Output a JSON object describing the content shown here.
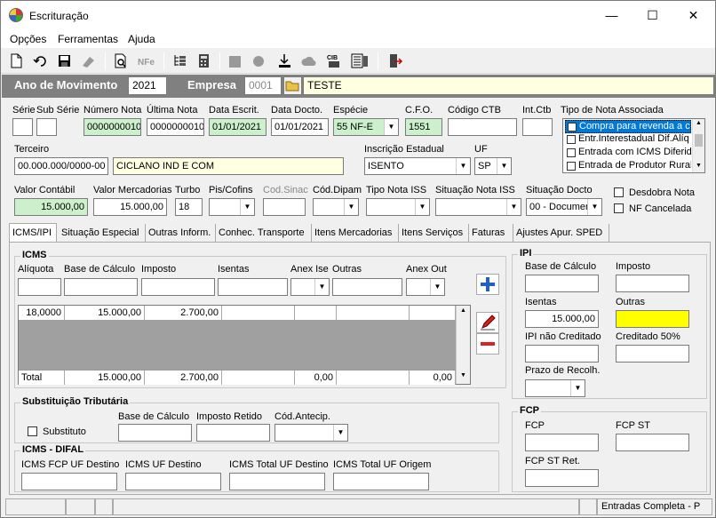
{
  "window": {
    "title": "Escrituração",
    "minimize": "—",
    "maximize": "☐",
    "close": "✕"
  },
  "menu": [
    "Opções",
    "Ferramentas",
    "Ajuda"
  ],
  "header": {
    "ano_label": "Ano de Movimento",
    "ano_value": "2021",
    "empresa_label": "Empresa",
    "empresa_code": "0001",
    "empresa_name": "TESTE"
  },
  "row1": {
    "serie_label": "Série",
    "subserie_label": "Sub Série",
    "numero_label": "Número Nota",
    "numero_value": "0000000010",
    "ultima_label": "Última Nota",
    "ultima_value": "0000000010",
    "data_escrit_label": "Data Escrit.",
    "data_escrit_value": "01/01/2021",
    "data_docto_label": "Data Docto.",
    "data_docto_value": "01/01/2021",
    "especie_label": "Espécie",
    "especie_value": "55  NF-E",
    "cfo_label": "C.F.O.",
    "cfo_value": "1551",
    "ctb_label": "Código CTB",
    "intctb_label": "Int.Ctb",
    "tipo_nota_label": "Tipo de Nota Associada",
    "tipo_nota_items": [
      "Compra para revenda a co",
      "Entr.Interestadual Dif.Alíq",
      "Entrada com ICMS Diferido",
      "Entrada de Produtor Rural"
    ]
  },
  "row2": {
    "terceiro_label": "Terceiro",
    "terceiro_doc": "00.000.000/0000-00",
    "terceiro_name": "CICLANO IND E COM",
    "ie_label": "Inscrição Estadual",
    "ie_value": "ISENTO",
    "uf_label": "UF",
    "uf_value": "SP"
  },
  "row3": {
    "valor_contabil_label": "Valor Contábil",
    "valor_contabil_value": "15.000,00",
    "valor_merc_label": "Valor Mercadorias",
    "valor_merc_value": "15.000,00",
    "turbo_label": "Turbo",
    "turbo_value": "18",
    "piscofins_label": "Pis/Cofins",
    "codsinac_label": "Cod.Sinac",
    "coddipam_label": "Cód.Dipam",
    "tipo_iss_label": "Tipo Nota ISS",
    "sit_iss_label": "Situação Nota ISS",
    "sit_docto_label": "Situação Docto",
    "sit_docto_value": "00 - Documer",
    "desdobra_label": "Desdobra Nota",
    "cancelada_label": "NF Cancelada"
  },
  "tabs": [
    "ICMS/IPI",
    "Situação Especial",
    "Outras Inform.",
    "Conhec. Transporte",
    "Itens Mercadorias",
    "Itens Serviços",
    "Faturas",
    "Ajustes Apur. SPED"
  ],
  "icms": {
    "title": "ICMS",
    "aliquota_label": "Alíquota",
    "base_label": "Base de Cálculo",
    "imposto_label": "Imposto",
    "isentas_label": "Isentas",
    "anexise_label": "Anex Ise",
    "outras_label": "Outras",
    "anexout_label": "Anex Out",
    "row": [
      "18,0000",
      "15.000,00",
      "2.700,00",
      "",
      "",
      "",
      ""
    ],
    "total": [
      "Total",
      "15.000,00",
      "2.700,00",
      "",
      "0,00",
      "",
      "0,00"
    ]
  },
  "st": {
    "title": "Substituição Tributária",
    "substituto_label": "Substituto",
    "base_label": "Base de Cálculo",
    "imposto_label": "Imposto Retido",
    "codantecip_label": "Cód.Antecip."
  },
  "difal": {
    "title": "ICMS - DIFAL",
    "fcp_label": "ICMS FCP UF Destino",
    "uf_dest_label": "ICMS UF Destino",
    "total_dest_label": "ICMS Total UF Destino",
    "total_orig_label": "ICMS Total UF Origem"
  },
  "ipi": {
    "title": "IPI",
    "base_label": "Base de Cálculo",
    "imposto_label": "Imposto",
    "isentas_label": "Isentas",
    "isentas_value": "15.000,00",
    "outras_label": "Outras",
    "naocred_label": "IPI não Creditado",
    "cred50_label": "Creditado 50%",
    "prazo_label": "Prazo de Recolh."
  },
  "fcp": {
    "title": "FCP",
    "fcp_label": "FCP",
    "fcpst_label": "FCP ST",
    "fcpstret_label": "FCP ST Ret."
  },
  "status": {
    "text": "Entradas Completa - P"
  },
  "colors": {
    "band": "#808080",
    "green": "#ccf0cc",
    "yellow": "#ffffe1",
    "highlight": "#ffff00",
    "accent": "#0078d7"
  }
}
